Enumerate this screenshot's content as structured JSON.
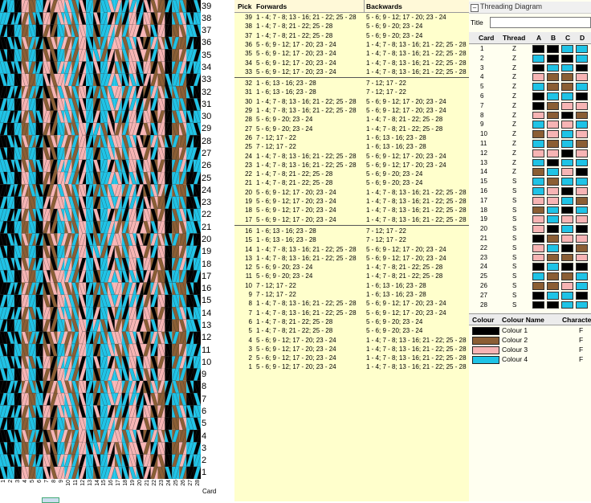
{
  "colors": {
    "1": "#000000",
    "2": "#8b5e34",
    "3": "#f7b4b4",
    "4": "#1fc3e6"
  },
  "weave": {
    "picks": [
      "39",
      "38",
      "37",
      "36",
      "35",
      "34",
      "33",
      "32",
      "31",
      "30",
      "29",
      "28",
      "27",
      "26",
      "25",
      "24",
      "23",
      "22",
      "21",
      "20",
      "19",
      "18",
      "17",
      "16",
      "15",
      "14",
      "13",
      "12",
      "11",
      "10",
      "9",
      "8",
      "7",
      "6",
      "5",
      "4",
      "3",
      "2",
      "1"
    ],
    "cards": [
      "1",
      "2",
      "3",
      "4",
      "5",
      "6",
      "7",
      "8",
      "9",
      "10",
      "11",
      "12",
      "13",
      "14",
      "15",
      "16",
      "17",
      "18",
      "19",
      "20",
      "21",
      "22",
      "23",
      "24",
      "25",
      "26",
      "27",
      "28"
    ],
    "card_label": "Card"
  },
  "pick_table": {
    "headers": {
      "pick": "Pick",
      "forwards": "Forwards",
      "backwards": "Backwards"
    },
    "rows": [
      {
        "pick": "39",
        "fw": "1 - 4; 7 - 8; 13 - 16; 21 - 22; 25 - 28",
        "bw": "5 - 6; 9 - 12; 17 - 20; 23 - 24"
      },
      {
        "pick": "38",
        "fw": "1 - 4; 7 - 8; 21 - 22; 25 - 28",
        "bw": "5 - 6; 9 - 20; 23 - 24"
      },
      {
        "pick": "37",
        "fw": "1 - 4; 7 - 8; 21 - 22; 25 - 28",
        "bw": "5 - 6; 9 - 20; 23 - 24"
      },
      {
        "pick": "36",
        "fw": "5 - 6; 9 - 12; 17 - 20; 23 - 24",
        "bw": "1 - 4; 7 - 8; 13 - 16; 21 - 22; 25 - 28"
      },
      {
        "pick": "35",
        "fw": "5 - 6; 9 - 12; 17 - 20; 23 - 24",
        "bw": "1 - 4; 7 - 8; 13 - 16; 21 - 22; 25 - 28"
      },
      {
        "pick": "34",
        "fw": "5 - 6; 9 - 12; 17 - 20; 23 - 24",
        "bw": "1 - 4; 7 - 8; 13 - 16; 21 - 22; 25 - 28"
      },
      {
        "pick": "33",
        "fw": "5 - 6; 9 - 12; 17 - 20; 23 - 24",
        "bw": "1 - 4; 7 - 8; 13 - 16; 21 - 22; 25 - 28"
      },
      {
        "pick": "32",
        "fw": "1 - 6; 13 - 16; 23 - 28",
        "bw": "7 - 12; 17 - 22"
      },
      {
        "pick": "31",
        "fw": "1 - 6; 13 - 16; 23 - 28",
        "bw": "7 - 12; 17 - 22"
      },
      {
        "pick": "30",
        "fw": "1 - 4; 7 - 8; 13 - 16; 21 - 22; 25 - 28",
        "bw": "5 - 6; 9 - 12; 17 - 20; 23 - 24"
      },
      {
        "pick": "29",
        "fw": "1 - 4; 7 - 8; 13 - 16; 21 - 22; 25 - 28",
        "bw": "5 - 6; 9 - 12; 17 - 20; 23 - 24"
      },
      {
        "pick": "28",
        "fw": "5 - 6; 9 - 20; 23 - 24",
        "bw": "1 - 4; 7 - 8; 21 - 22; 25 - 28"
      },
      {
        "pick": "27",
        "fw": "5 - 6; 9 - 20; 23 - 24",
        "bw": "1 - 4; 7 - 8; 21 - 22; 25 - 28"
      },
      {
        "pick": "26",
        "fw": "7 - 12; 17 - 22",
        "bw": "1 - 6; 13 - 16; 23 - 28"
      },
      {
        "pick": "25",
        "fw": "7 - 12; 17 - 22",
        "bw": "1 - 6; 13 - 16; 23 - 28"
      },
      {
        "pick": "24",
        "fw": "1 - 4; 7 - 8; 13 - 16; 21 - 22; 25 - 28",
        "bw": "5 - 6; 9 - 12; 17 - 20; 23 - 24"
      },
      {
        "pick": "23",
        "fw": "1 - 4; 7 - 8; 13 - 16; 21 - 22; 25 - 28",
        "bw": "5 - 6; 9 - 12; 17 - 20; 23 - 24"
      },
      {
        "pick": "22",
        "fw": "1 - 4; 7 - 8; 21 - 22; 25 - 28",
        "bw": "5 - 6; 9 - 20; 23 - 24"
      },
      {
        "pick": "21",
        "fw": "1 - 4; 7 - 8; 21 - 22; 25 - 28",
        "bw": "5 - 6; 9 - 20; 23 - 24"
      },
      {
        "pick": "20",
        "fw": "5 - 6; 9 - 12; 17 - 20; 23 - 24",
        "bw": "1 - 4; 7 - 8; 13 - 16; 21 - 22; 25 - 28"
      },
      {
        "pick": "19",
        "fw": "5 - 6; 9 - 12; 17 - 20; 23 - 24",
        "bw": "1 - 4; 7 - 8; 13 - 16; 21 - 22; 25 - 28"
      },
      {
        "pick": "18",
        "fw": "5 - 6; 9 - 12; 17 - 20; 23 - 24",
        "bw": "1 - 4; 7 - 8; 13 - 16; 21 - 22; 25 - 28"
      },
      {
        "pick": "17",
        "fw": "5 - 6; 9 - 12; 17 - 20; 23 - 24",
        "bw": "1 - 4; 7 - 8; 13 - 16; 21 - 22; 25 - 28"
      },
      {
        "pick": "16",
        "fw": "1 - 6; 13 - 16; 23 - 28",
        "bw": "7 - 12; 17 - 22"
      },
      {
        "pick": "15",
        "fw": "1 - 6; 13 - 16; 23 - 28",
        "bw": "7 - 12; 17 - 22"
      },
      {
        "pick": "14",
        "fw": "1 - 4; 7 - 8; 13 - 16; 21 - 22; 25 - 28",
        "bw": "5 - 6; 9 - 12; 17 - 20; 23 - 24"
      },
      {
        "pick": "13",
        "fw": "1 - 4; 7 - 8; 13 - 16; 21 - 22; 25 - 28",
        "bw": "5 - 6; 9 - 12; 17 - 20; 23 - 24"
      },
      {
        "pick": "12",
        "fw": "5 - 6; 9 - 20; 23 - 24",
        "bw": "1 - 4; 7 - 8; 21 - 22; 25 - 28"
      },
      {
        "pick": "11",
        "fw": "5 - 6; 9 - 20; 23 - 24",
        "bw": "1 - 4; 7 - 8; 21 - 22; 25 - 28"
      },
      {
        "pick": "10",
        "fw": "7 - 12; 17 - 22",
        "bw": "1 - 6; 13 - 16; 23 - 28"
      },
      {
        "pick": "9",
        "fw": "7 - 12; 17 - 22",
        "bw": "1 - 6; 13 - 16; 23 - 28"
      },
      {
        "pick": "8",
        "fw": "1 - 4; 7 - 8; 13 - 16; 21 - 22; 25 - 28",
        "bw": "5 - 6; 9 - 12; 17 - 20; 23 - 24"
      },
      {
        "pick": "7",
        "fw": "1 - 4; 7 - 8; 13 - 16; 21 - 22; 25 - 28",
        "bw": "5 - 6; 9 - 12; 17 - 20; 23 - 24"
      },
      {
        "pick": "6",
        "fw": "1 - 4; 7 - 8; 21 - 22; 25 - 28",
        "bw": "5 - 6; 9 - 20; 23 - 24"
      },
      {
        "pick": "5",
        "fw": "1 - 4; 7 - 8; 21 - 22; 25 - 28",
        "bw": "5 - 6; 9 - 20; 23 - 24"
      },
      {
        "pick": "4",
        "fw": "5 - 6; 9 - 12; 17 - 20; 23 - 24",
        "bw": "1 - 4; 7 - 8; 13 - 16; 21 - 22; 25 - 28"
      },
      {
        "pick": "3",
        "fw": "5 - 6; 9 - 12; 17 - 20; 23 - 24",
        "bw": "1 - 4; 7 - 8; 13 - 16; 21 - 22; 25 - 28"
      },
      {
        "pick": "2",
        "fw": "5 - 6; 9 - 12; 17 - 20; 23 - 24",
        "bw": "1 - 4; 7 - 8; 13 - 16; 21 - 22; 25 - 28"
      },
      {
        "pick": "1",
        "fw": "5 - 6; 9 - 12; 17 - 20; 23 - 24",
        "bw": "1 - 4; 7 - 8; 13 - 16; 21 - 22; 25 - 28"
      }
    ]
  },
  "threading": {
    "window_title": "Threading Diagram",
    "title_label": "Title",
    "title_value": "",
    "headers": {
      "card": "Card",
      "thread": "Thread",
      "a": "A",
      "b": "B",
      "c": "C",
      "d": "D"
    },
    "cards": [
      {
        "card": "1",
        "thread": "Z",
        "holes": [
          1,
          1,
          4,
          4
        ]
      },
      {
        "card": "2",
        "thread": "Z",
        "holes": [
          4,
          1,
          1,
          4
        ]
      },
      {
        "card": "3",
        "thread": "Z",
        "holes": [
          1,
          4,
          4,
          1
        ]
      },
      {
        "card": "4",
        "thread": "Z",
        "holes": [
          3,
          2,
          2,
          3
        ]
      },
      {
        "card": "5",
        "thread": "Z",
        "holes": [
          4,
          2,
          2,
          4
        ]
      },
      {
        "card": "6",
        "thread": "Z",
        "holes": [
          1,
          4,
          4,
          1
        ]
      },
      {
        "card": "7",
        "thread": "Z",
        "holes": [
          1,
          2,
          3,
          3
        ]
      },
      {
        "card": "8",
        "thread": "Z",
        "holes": [
          3,
          2,
          1,
          2
        ]
      },
      {
        "card": "9",
        "thread": "Z",
        "holes": [
          4,
          3,
          3,
          4
        ]
      },
      {
        "card": "10",
        "thread": "Z",
        "holes": [
          2,
          3,
          4,
          3
        ]
      },
      {
        "card": "11",
        "thread": "Z",
        "holes": [
          4,
          2,
          4,
          2
        ]
      },
      {
        "card": "12",
        "thread": "Z",
        "holes": [
          3,
          3,
          1,
          3
        ]
      },
      {
        "card": "13",
        "thread": "Z",
        "holes": [
          4,
          1,
          4,
          4
        ]
      },
      {
        "card": "14",
        "thread": "Z",
        "holes": [
          2,
          4,
          3,
          1
        ]
      },
      {
        "card": "15",
        "thread": "S",
        "holes": [
          4,
          2,
          4,
          4
        ]
      },
      {
        "card": "16",
        "thread": "S",
        "holes": [
          4,
          3,
          1,
          3
        ]
      },
      {
        "card": "17",
        "thread": "S",
        "holes": [
          3,
          3,
          4,
          2
        ]
      },
      {
        "card": "18",
        "thread": "S",
        "holes": [
          2,
          4,
          1,
          4
        ]
      },
      {
        "card": "19",
        "thread": "S",
        "holes": [
          3,
          4,
          3,
          3
        ]
      },
      {
        "card": "20",
        "thread": "S",
        "holes": [
          3,
          1,
          4,
          1
        ]
      },
      {
        "card": "21",
        "thread": "S",
        "holes": [
          1,
          2,
          3,
          3
        ]
      },
      {
        "card": "22",
        "thread": "S",
        "holes": [
          3,
          4,
          1,
          2
        ]
      },
      {
        "card": "23",
        "thread": "S",
        "holes": [
          3,
          2,
          2,
          3
        ]
      },
      {
        "card": "24",
        "thread": "S",
        "holes": [
          1,
          4,
          1,
          1
        ]
      },
      {
        "card": "25",
        "thread": "S",
        "holes": [
          4,
          2,
          2,
          4
        ]
      },
      {
        "card": "26",
        "thread": "S",
        "holes": [
          2,
          2,
          3,
          4
        ]
      },
      {
        "card": "27",
        "thread": "S",
        "holes": [
          1,
          4,
          4,
          1
        ]
      },
      {
        "card": "28",
        "thread": "S",
        "holes": [
          1,
          1,
          4,
          4
        ]
      }
    ]
  },
  "colour_table": {
    "headers": {
      "colour": "Colour",
      "name": "Colour Name",
      "character": "Characte"
    },
    "rows": [
      {
        "id": "1",
        "name": "Colour 1",
        "character": "F",
        "hex": "#000000"
      },
      {
        "id": "2",
        "name": "Colour 2",
        "character": "F",
        "hex": "#8b5e34"
      },
      {
        "id": "3",
        "name": "Colour 3",
        "character": "F",
        "hex": "#f7b4b4"
      },
      {
        "id": "4",
        "name": "Colour 4",
        "character": "F",
        "hex": "#1fc3e6"
      }
    ]
  }
}
